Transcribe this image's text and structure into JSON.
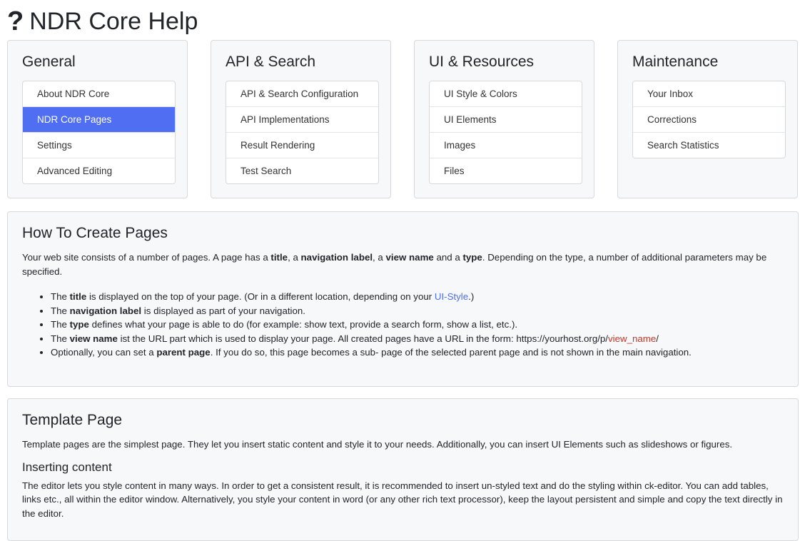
{
  "header": {
    "icon": "question-mark-icon",
    "icon_glyph": "?",
    "title": "NDR Core Help"
  },
  "cards": [
    {
      "title": "General",
      "items": [
        "About NDR Core",
        "NDR Core Pages",
        "Settings",
        "Advanced Editing"
      ],
      "active_index": 1
    },
    {
      "title": "API & Search",
      "items": [
        "API & Search Configuration",
        "API Implementations",
        "Result Rendering",
        "Test Search"
      ]
    },
    {
      "title": "UI & Resources",
      "items": [
        "UI Style & Colors",
        "UI Elements",
        "Images",
        "Files"
      ]
    },
    {
      "title": "Maintenance",
      "items": [
        "Your Inbox",
        "Corrections",
        "Search Statistics"
      ]
    }
  ],
  "colors": {
    "accent": "#4f6ef2",
    "link_red": "#c0392b"
  },
  "how_to": {
    "title": "How To Create Pages",
    "intro": {
      "p1": "Your web site consists of a number of pages. A page has a ",
      "b1": "title",
      "p2": ", a ",
      "b2": "navigation label",
      "p3": ", a ",
      "b3": "view name",
      "p4": " and a ",
      "b4": "type",
      "p5": ". Depending on the type, a number of additional parameters may be specified."
    },
    "bullets": {
      "b1": {
        "t1": "The ",
        "bold": "title",
        "t2": " is displayed on the top of your page. (Or in a different location, depending on your ",
        "link": "UI-Style",
        "t3": ".)"
      },
      "b2": {
        "t1": "The ",
        "bold": "navigation label",
        "t2": " is displayed as part of your navigation."
      },
      "b3": {
        "t1": "The ",
        "bold": "type",
        "t2": " defines what your page is able to do (for example: show text, provide a search form, show a list, etc.)."
      },
      "b4": {
        "t1": "The ",
        "bold": "view name",
        "t2": " ist the URL part which is used to display your page. All created pages have a URL in the form: https://yourhost.org/p/",
        "link": "view_name",
        "t3": "/"
      },
      "b5": {
        "t1": "Optionally, you can set a ",
        "bold": "parent page",
        "t2": ". If you do so, this page becomes a sub- page of the selected parent page and is not shown in the main navigation."
      }
    }
  },
  "template_page": {
    "title": "Template Page",
    "intro": "Template pages are the simplest page. They let you insert static content and style it to your needs. Additionally, you can insert UI Elements such as slideshows or figures.",
    "sub_title": "Inserting content",
    "sub_text": "The editor lets you style content in many ways. In order to get a consistent result, it is recommended to insert un-styled text and do the styling within ck-editor. You can add tables, links etc., all within the editor window. Alternatively, you style your content in word (or any other rich text processor), keep the layout persistent and simple and copy the text directly in the editor."
  }
}
